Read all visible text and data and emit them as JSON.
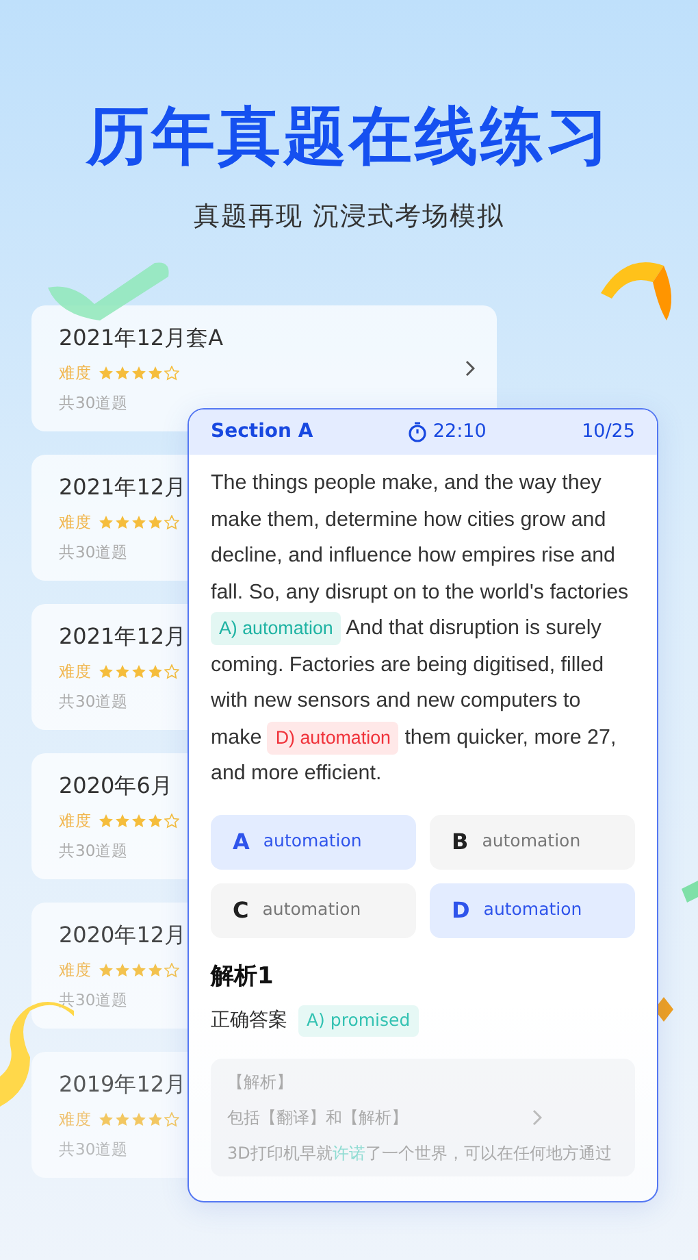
{
  "headline": "历年真题在线练习",
  "subtitle": "真题再现 沉浸式考场模拟",
  "cards": [
    {
      "title": "2021年12月套A",
      "difficulty_label": "难度",
      "stars": 4,
      "count": "共30道题",
      "chevron": true
    },
    {
      "title": "2021年12月",
      "difficulty_label": "难度",
      "stars": 4,
      "count": "共30道题",
      "chevron": false
    },
    {
      "title": "2021年12月",
      "difficulty_label": "难度",
      "stars": 4,
      "count": "共30道题",
      "chevron": false
    },
    {
      "title": "2020年6月",
      "difficulty_label": "难度",
      "stars": 4,
      "count": "共30道题",
      "chevron": false
    },
    {
      "title": "2020年12月",
      "difficulty_label": "难度",
      "stars": 4,
      "count": "共30道题",
      "chevron": false
    },
    {
      "title": "2019年12月",
      "difficulty_label": "难度",
      "stars": 4,
      "count": "共30道题",
      "chevron": false
    }
  ],
  "question": {
    "section": "Section A",
    "timer": "22:10",
    "progress": "10/25",
    "passage": [
      {
        "kind": "text",
        "text": "The things people make, and the way they make them, determine how cities grow and decline, and influence how empires rise and fall. So, any disrupt on to the world's factories"
      },
      {
        "kind": "blank",
        "text": "A) automation",
        "correct": true
      },
      {
        "kind": "text",
        "text": "And that disruption is surely coming. Factories are being digitised, filled with new sensors and new computers to make"
      },
      {
        "kind": "blank",
        "text": "D) automation",
        "correct": false
      },
      {
        "kind": "text",
        "text": "them quicker, more 27, and more efficient."
      }
    ],
    "options": [
      {
        "letter": "A",
        "text": "automation",
        "selected": true
      },
      {
        "letter": "B",
        "text": "automation",
        "selected": false
      },
      {
        "letter": "C",
        "text": "automation",
        "selected": false
      },
      {
        "letter": "D",
        "text": "automation",
        "selected": true
      }
    ]
  },
  "analysis": {
    "title": "解析1",
    "answer_label": "正确答案",
    "answer": "A) promised",
    "box_title": "【解析】",
    "box_subtitle": "包括【翻译】和【解析】",
    "box_text": {
      "before": "3D打印机早就",
      "highlight": "许诺",
      "after": "了一个世界，可以在任何地方通过"
    }
  }
}
